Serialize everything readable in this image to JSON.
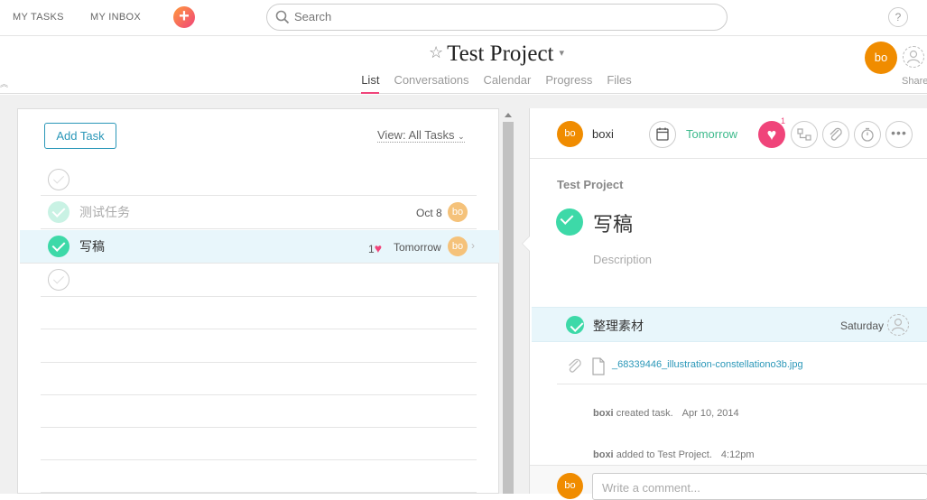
{
  "topbar": {
    "my_tasks": "MY TASKS",
    "my_inbox": "MY INBOX",
    "add_icon": "plus",
    "search_placeholder": "Search",
    "help_label": "?"
  },
  "project": {
    "title": "Test Project",
    "tabs": [
      "List",
      "Conversations",
      "Calendar",
      "Progress",
      "Files"
    ],
    "active_tab": "List",
    "owner_avatar": "bo",
    "share_label": "Share"
  },
  "list": {
    "add_task_label": "Add Task",
    "view_label": "View: All Tasks",
    "tasks": [
      {
        "name": "测试任务",
        "date": "Oct 8",
        "assignee": "bo",
        "completed": true
      },
      {
        "name": "写稿",
        "hearts": "1",
        "date": "Tomorrow",
        "assignee": "bo",
        "completed": true
      }
    ]
  },
  "detail": {
    "assignee_avatar": "bo",
    "assignee_name": "boxi",
    "due": "Tomorrow",
    "heart_count": "1",
    "project_name": "Test Project",
    "task_title": "写稿",
    "description_placeholder": "Description",
    "subtask": {
      "name": "整理素材",
      "due": "Saturday"
    },
    "attachment": "_68339446_illustration-constellationo3b.jpg",
    "activity": [
      {
        "user": "boxi",
        "text": "created task.",
        "time": "Apr 10, 2014"
      },
      {
        "user": "boxi",
        "text": "added to Test Project.",
        "time": "4:12pm"
      }
    ],
    "comment_avatar": "bo",
    "comment_placeholder": "Write a comment..."
  },
  "colors": {
    "accent_teal": "#2a97b8",
    "check_green": "#3dd9a8",
    "avatar_orange": "#f08c00",
    "heart_pink": "#f0447a",
    "selected_row": "#e8f6fb"
  }
}
